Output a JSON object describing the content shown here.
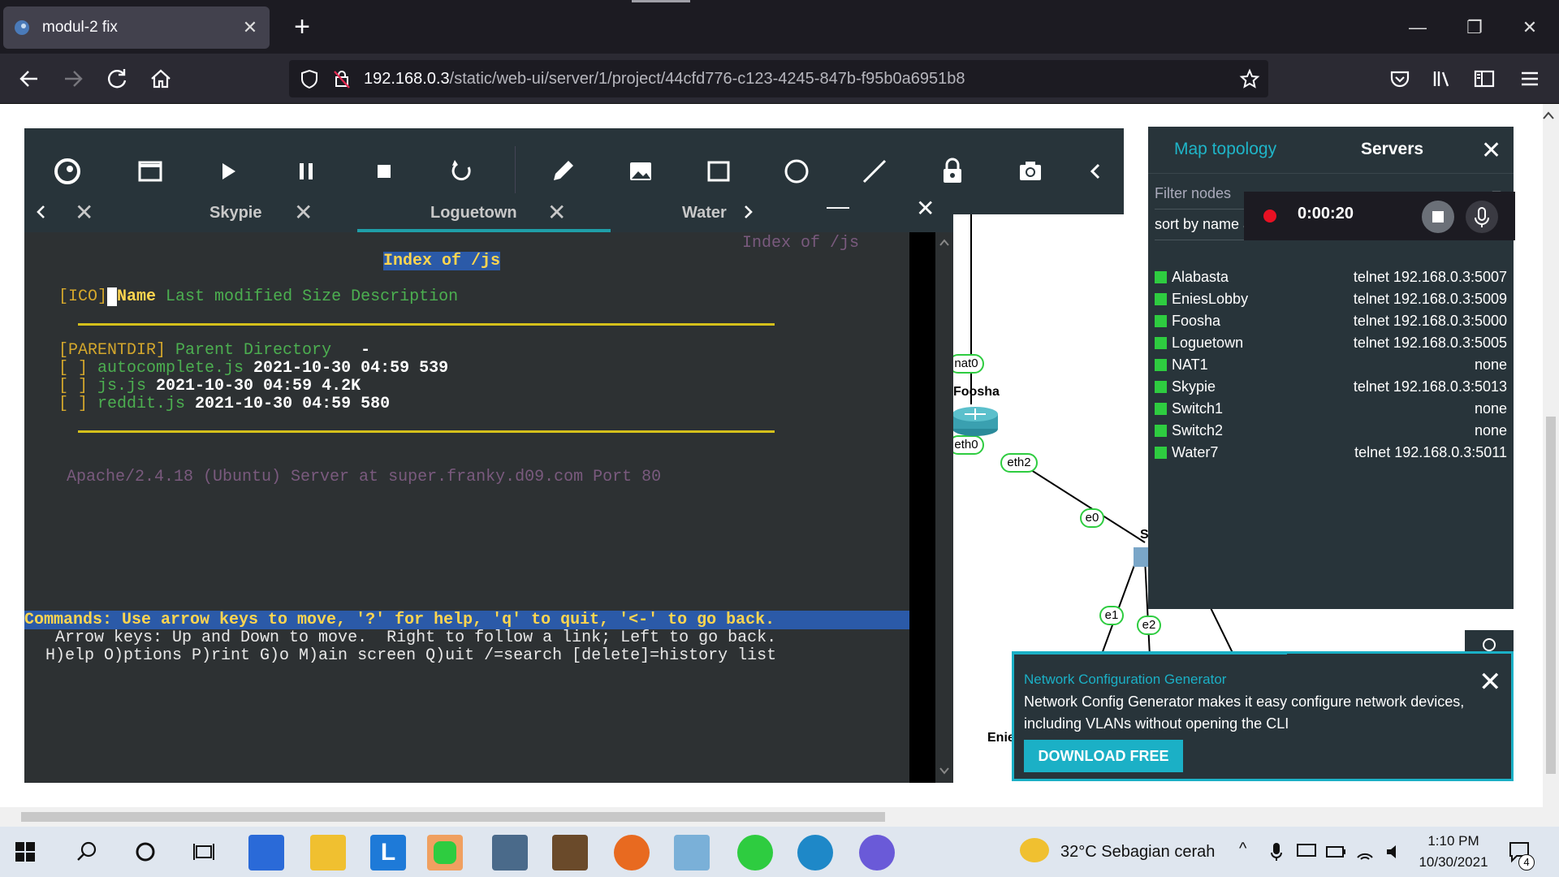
{
  "browser": {
    "tab_title": "modul-2 fix",
    "url_host": "192.168.0.3",
    "url_path": "/static/web-ui/server/1/project/44cfd776-c123-4245-847b-f95b0a6951b8"
  },
  "recording": {
    "time": "0:00:20"
  },
  "console": {
    "tabs": [
      "Skypie",
      "Loguetown",
      "Water"
    ],
    "active_tab": "Loguetown",
    "ghost_title": "Index of /js",
    "heading": "Index of /js",
    "columns_prefix": "[ICO]",
    "columns_name": "Name",
    "columns_rest": " Last modified Size Description",
    "parent_label": "[PARENTDIR]",
    "parent_text": " Parent Directory",
    "parent_dash": "   -",
    "files": [
      {
        "icon": "[ ] ",
        "name": "autocomplete.js",
        "meta": " 2021-10-30 04:59 539"
      },
      {
        "icon": "[ ] ",
        "name": "js.js",
        "meta": " 2021-10-30 04:59 4.2K"
      },
      {
        "icon": "[ ] ",
        "name": "reddit.js",
        "meta": " 2021-10-30 04:59 580"
      }
    ],
    "footer": "Apache/2.4.18 (Ubuntu) Server at super.franky.d09.com Port 80",
    "commands": "Commands: Use arrow keys to move, '?' for help, 'q' to quit, '<-' to go back.",
    "help1": "  Arrow keys: Up and Down to move.  Right to follow a link; Left to go back.",
    "help2": " H)elp O)ptions P)rint G)o M)ain screen Q)uit /=search [delete]=history list"
  },
  "topology": {
    "labels": {
      "nat0": "nat0",
      "eth0": "eth0",
      "foosha": "Foosha",
      "eth2": "eth2",
      "e0": "e0",
      "e1": "e1",
      "e2": "e2",
      "s": "S",
      "enies": "Enie"
    }
  },
  "nodes_panel": {
    "tab_map": "Map topology",
    "tab_servers": "Servers",
    "filter_placeholder": "Filter nodes",
    "sort": "sort by name ascending",
    "nodes": [
      {
        "name": "Alabasta",
        "console": "telnet 192.168.0.3:5007"
      },
      {
        "name": "EniesLobby",
        "console": "telnet 192.168.0.3:5009"
      },
      {
        "name": "Foosha",
        "console": "telnet 192.168.0.3:5000"
      },
      {
        "name": "Loguetown",
        "console": "telnet 192.168.0.3:5005"
      },
      {
        "name": "NAT1",
        "console": "none"
      },
      {
        "name": "Skypie",
        "console": "telnet 192.168.0.3:5013"
      },
      {
        "name": "Switch1",
        "console": "none"
      },
      {
        "name": "Switch2",
        "console": "none"
      },
      {
        "name": "Water7",
        "console": "telnet 192.168.0.3:5011"
      }
    ]
  },
  "notification": {
    "title": "Network Configuration Generator",
    "body": "Network Config Generator makes it easy configure network devices, including VLANs without opening the CLI",
    "button": "DOWNLOAD FREE"
  },
  "taskbar": {
    "weather": "32°C  Sebagian cerah",
    "time": "1:10 PM",
    "date": "10/30/2021",
    "notif_count": "4"
  },
  "colors": {
    "accent": "#1bb0c6",
    "toolbar": "#28343a",
    "node_status": "#2ecc40"
  }
}
